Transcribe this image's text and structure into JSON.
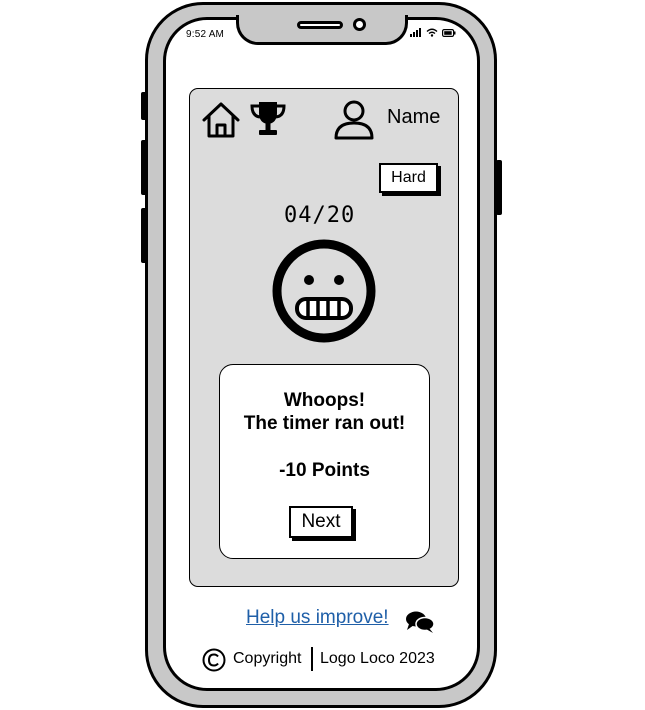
{
  "status_bar": {
    "time": "9:52 AM"
  },
  "header": {
    "user_name": "Name"
  },
  "quiz": {
    "difficulty": "Hard",
    "progress": "04/20",
    "result_title": "Whoops!",
    "result_message": "The timer ran out!",
    "result_points": "-10 Points",
    "next_label": "Next"
  },
  "footer": {
    "feedback_link": "Help us improve!",
    "copyright": "Copyright",
    "brand": "Logo Loco 2023"
  },
  "icons": {
    "home": "home-icon",
    "trophy": "trophy-icon",
    "user": "user-icon",
    "face": "grimace-face-icon",
    "chat": "chat-bubbles-icon",
    "copyright": "copyright-icon"
  }
}
